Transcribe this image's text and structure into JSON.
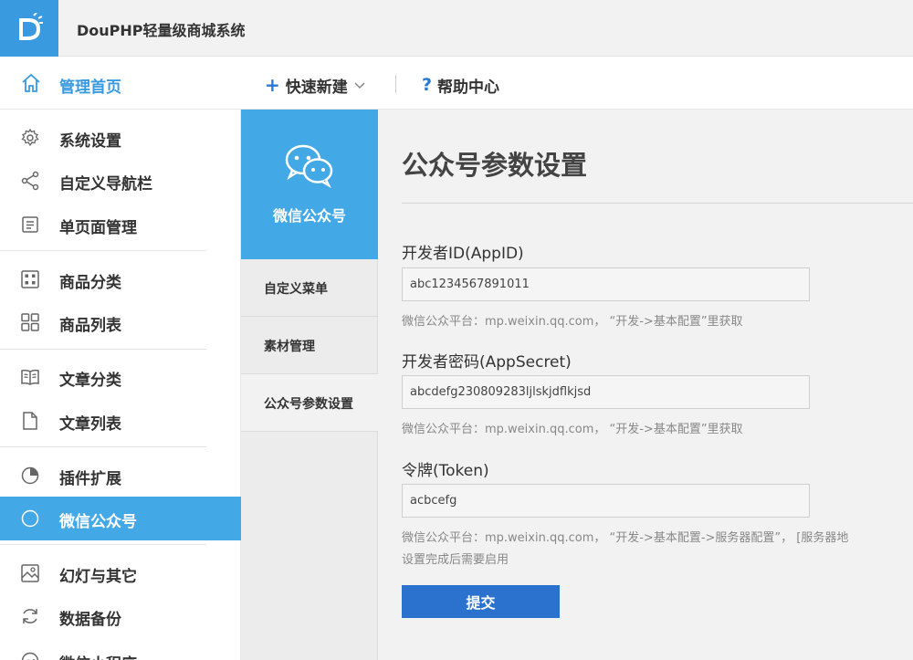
{
  "header": {
    "app_title": "DouPHP轻量级商城系统",
    "logo_letter": "D"
  },
  "nav": {
    "home_label": "管理首页",
    "quick_new_label": "快速新建",
    "help_label": "帮助中心"
  },
  "sidebar": {
    "items": [
      {
        "label": "系统设置",
        "icon": "gear-icon"
      },
      {
        "label": "自定义导航栏",
        "icon": "share-icon"
      },
      {
        "label": "单页面管理",
        "icon": "page-list-icon"
      },
      {
        "label": "商品分类",
        "icon": "grid-icon"
      },
      {
        "label": "商品列表",
        "icon": "four-squares-icon"
      },
      {
        "label": "文章分类",
        "icon": "book-icon"
      },
      {
        "label": "文章列表",
        "icon": "document-icon"
      },
      {
        "label": "插件扩展",
        "icon": "pie-icon"
      },
      {
        "label": "微信公众号",
        "icon": "circle-icon"
      },
      {
        "label": "幻灯与其它",
        "icon": "image-icon"
      },
      {
        "label": "数据备份",
        "icon": "refresh-icon"
      },
      {
        "label": "微信小程序",
        "icon": "miniprogram-icon"
      }
    ],
    "active_index": 8
  },
  "subnav": {
    "title": "微信公众号",
    "items": [
      "自定义菜单",
      "素材管理",
      "公众号参数设置"
    ],
    "active_index": 2
  },
  "main": {
    "title": "公众号参数设置",
    "fields": [
      {
        "label": "开发者ID(AppID)",
        "value": "abc1234567891011",
        "hint": "微信公众平台：mp.weixin.qq.com， “开发->基本配置”里获取"
      },
      {
        "label": "开发者密码(AppSecret)",
        "value": "abcdefg230809283ljlskjdflkjsd",
        "hint": "微信公众平台：mp.weixin.qq.com， “开发->基本配置”里获取"
      },
      {
        "label": "令牌(Token)",
        "value": "acbcefg",
        "hint": "微信公众平台：mp.weixin.qq.com， “开发->基本配置->服务器配置”， [服务器地",
        "hint2": "设置完成后需要启用"
      }
    ],
    "submit_label": "提交"
  },
  "colors": {
    "accent": "#43a8e6",
    "button": "#2b72ce",
    "logo_bg": "#3a9ae0"
  }
}
